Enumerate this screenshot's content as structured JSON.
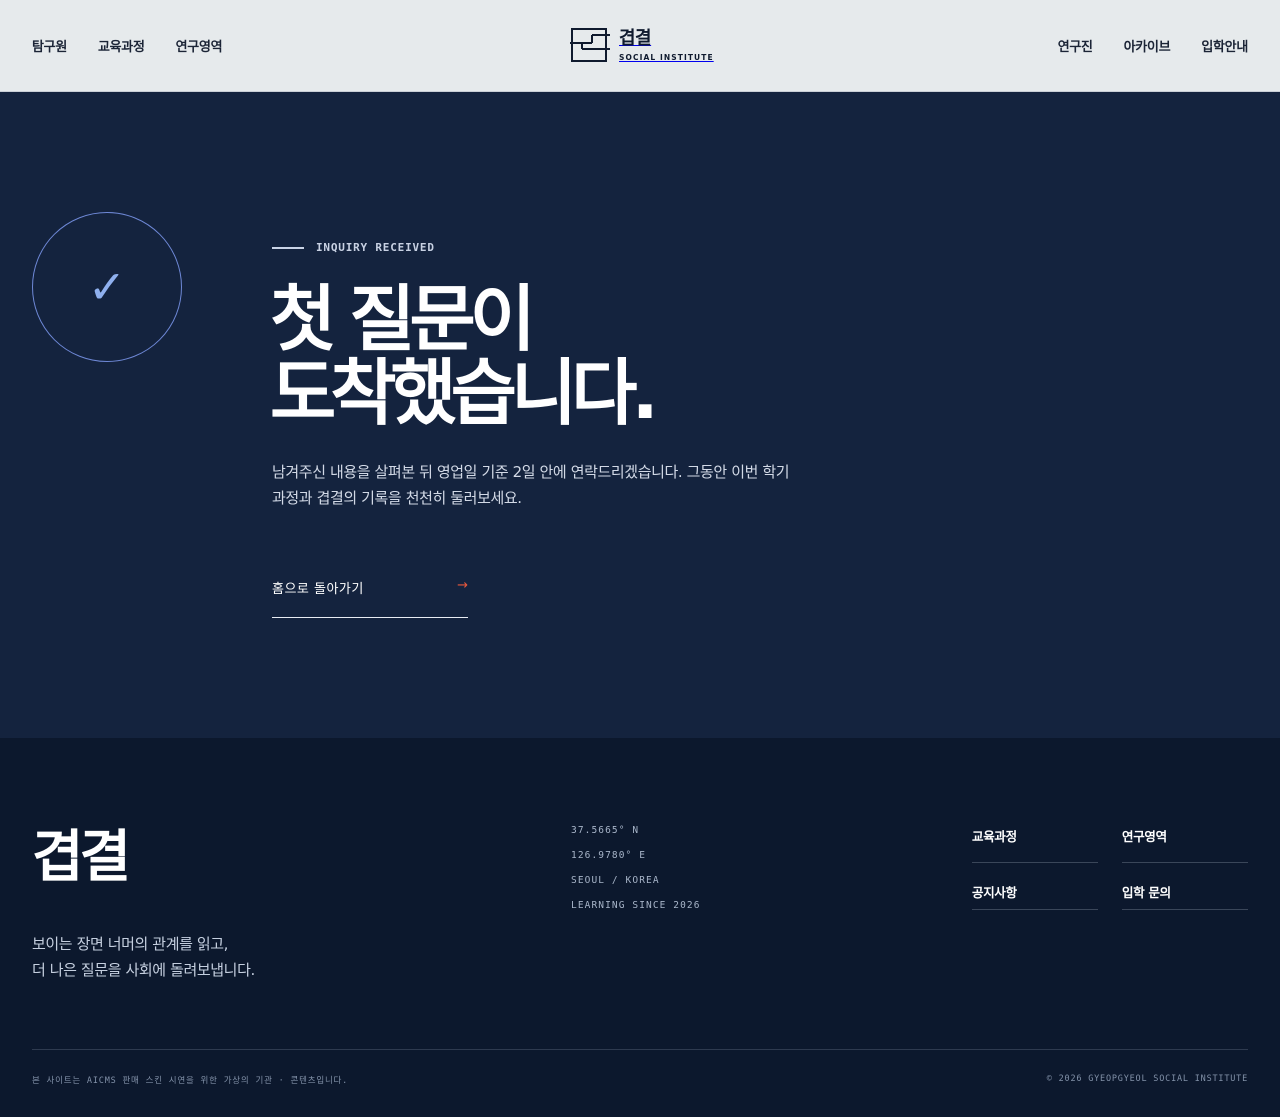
{
  "header": {
    "nav_left": [
      "탐구원",
      "교육과정",
      "연구영역"
    ],
    "nav_right": [
      "연구진",
      "아카이브",
      "입학안내"
    ],
    "logo_kr": "겹결",
    "logo_en": "SOCIAL INSTITUTE",
    "logo_icon": "layered-rect-logo-icon"
  },
  "hero": {
    "check_icon": "✓",
    "eyebrow": "INQUIRY RECEIVED",
    "title_lines": [
      "첫 질문이",
      "도착했습니다."
    ],
    "description_lines": [
      "남겨주신 내용을 살펴본 뒤 영업일 기준 2일 안에 연락드리겠습니다. 그동안 이번 학기",
      "과정과 겹결의 기록을 천천히 둘러보세요."
    ],
    "home_button_label": "홈으로 돌아가기",
    "home_button_arrow": "→"
  },
  "footer": {
    "logo": "겹결",
    "tagline_lines": [
      "보이는 장면 너머의 관계를 읽고,",
      "더 나은 질문을 사회에 돌려보냅니다."
    ],
    "coords": [
      "37.5665° N",
      "126.9780° E",
      "SEOUL / KOREA",
      "LEARNING SINCE 2026"
    ],
    "links": [
      "교육과정",
      "연구영역",
      "공지사항",
      "입학 문의"
    ],
    "note": "본 사이트는 AICMS 판매 스킨 시연을 위한 가상의 기관 · 콘텐츠입니다.",
    "copyright": "© 2026 GYEOPGYEOL SOCIAL INSTITUTE"
  },
  "colors": {
    "header_bg": "#e6eaec",
    "hero_bg": "#14233e",
    "footer_bg": "#0c182d",
    "accent_arrow": "#e9583c",
    "check_stroke": "#6e88d6"
  }
}
